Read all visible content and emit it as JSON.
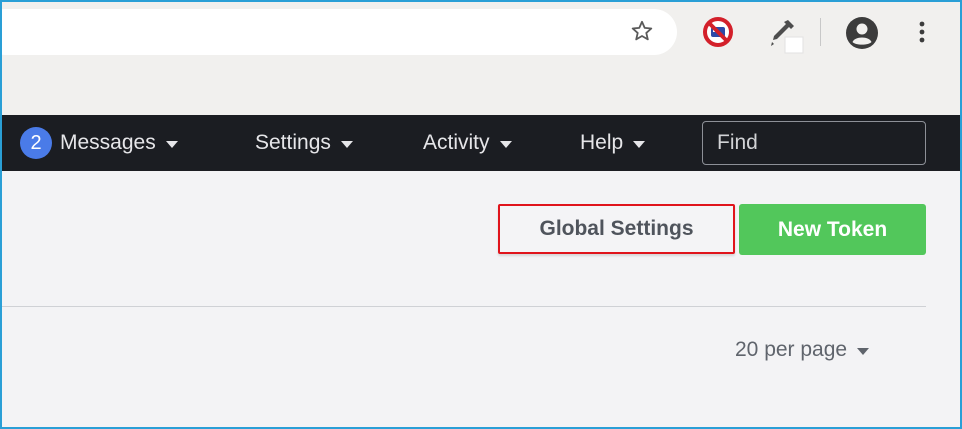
{
  "browser": {
    "icons": [
      "star-icon",
      "extension-icon",
      "eyedropper-icon",
      "account-icon",
      "more-vert-icon"
    ]
  },
  "navbar": {
    "messages": {
      "badge": "2",
      "label": "Messages"
    },
    "settings": {
      "label": "Settings"
    },
    "activity": {
      "label": "Activity"
    },
    "help": {
      "label": "Help"
    },
    "find": {
      "placeholder": "Find"
    }
  },
  "toolbar": {
    "global_settings_label": "Global Settings",
    "new_token_label": "New Token"
  },
  "pagination": {
    "per_page_label": "20 per page"
  },
  "colors": {
    "navbar_bg": "#1b1d22",
    "badge_bg": "#4a7be8",
    "new_token_bg": "#52c75b",
    "highlight_border": "#e0141c"
  }
}
